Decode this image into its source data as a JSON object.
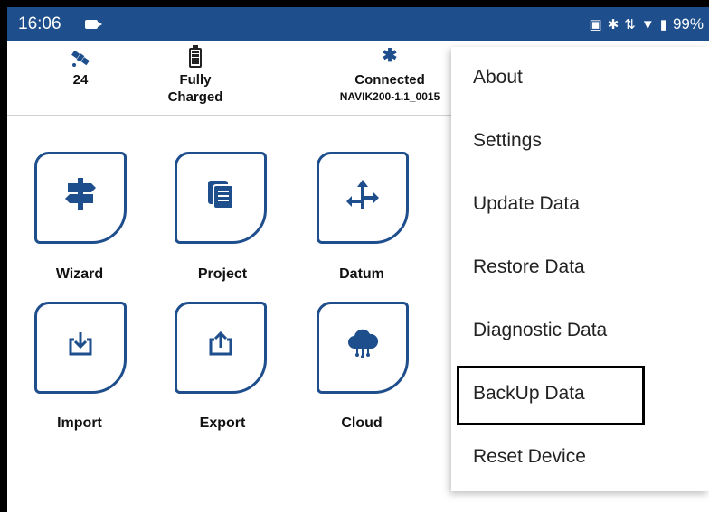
{
  "status_bar": {
    "time": "16:06",
    "battery_percent": "99%"
  },
  "info_bar": {
    "satellites": "24",
    "battery_line1": "Fully",
    "battery_line2": "Charged",
    "bt_status": "Connected",
    "device_name": "NAVIK200-1.1_0015"
  },
  "tiles": [
    {
      "label": "Wizard",
      "icon": "signpost-icon"
    },
    {
      "label": "Project",
      "icon": "documents-icon"
    },
    {
      "label": "Datum",
      "icon": "axis-arrows-icon"
    },
    {
      "label": "Import",
      "icon": "import-icon"
    },
    {
      "label": "Export",
      "icon": "export-icon"
    },
    {
      "label": "Cloud",
      "icon": "cloud-icon"
    }
  ],
  "menu": {
    "items": [
      "About",
      "Settings",
      "Update Data",
      "Restore Data",
      "Diagnostic Data",
      "BackUp Data",
      "Reset Device"
    ]
  },
  "colors": {
    "brand": "#1e4e8c"
  }
}
